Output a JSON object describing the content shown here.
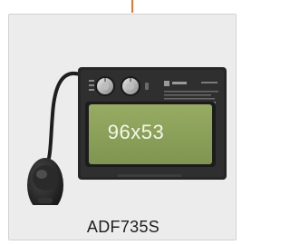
{
  "product": {
    "model": "ADF735S",
    "lens_size": "96x53"
  },
  "colors": {
    "accent": "#e07a2e",
    "card_bg": "#ececec",
    "lens": "#8fa45a",
    "housing": "#2a2a2a"
  }
}
